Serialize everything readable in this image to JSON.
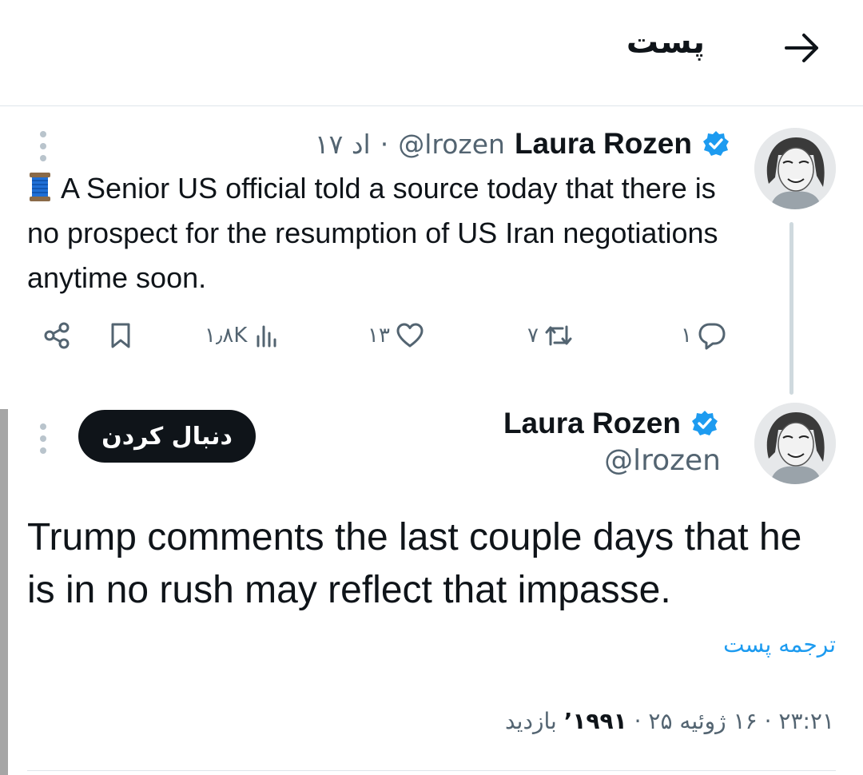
{
  "header": {
    "title": "پست",
    "back_icon": "arrow-right-icon"
  },
  "parent_tweet": {
    "author_name": "Laura Rozen",
    "handle": "@lrozen",
    "time_prefix": "·",
    "time": "۱۷ اد",
    "emoji_icon": "thread-spool-icon",
    "text": "A Senior US official told a source today that there is no prospect for the resumption of US Iran negotiations anytime soon.",
    "stats": {
      "replies": "۱",
      "reposts": "۷",
      "likes": "۱۳",
      "views": "۱٫۸K"
    }
  },
  "focused_tweet": {
    "author_name": "Laura Rozen",
    "handle": "@lrozen",
    "follow_label": "دنبال کردن",
    "text": "Trump comments the last couple days that he is in no rush may reflect that impasse.",
    "translate_label": "ترجمه پست",
    "timestamp_time": "۲۳:۲۱",
    "timestamp_date": "۱۶ ژوئیه ۲۵",
    "views_count": "۱۹۹۱",
    "views_label": "بازدید"
  },
  "colors": {
    "accent": "#1d9bf0",
    "text": "#0f1419",
    "muted": "#536471",
    "divider": "#dfe5ea"
  }
}
